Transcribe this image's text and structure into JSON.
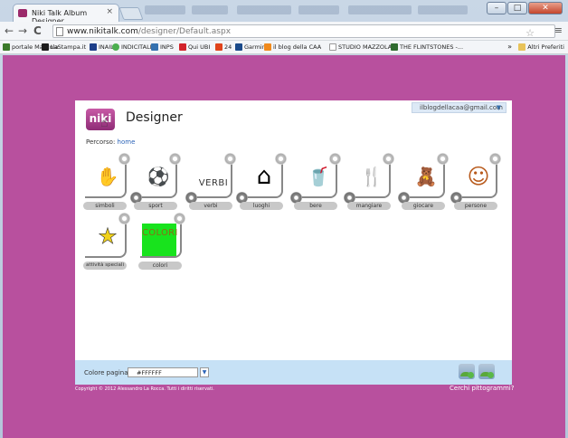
{
  "browser": {
    "tab_title": "Niki Talk Album Designer",
    "tab_close": "×",
    "url_host": "www.nikitalk.com",
    "url_path": "/designer/Default.aspx",
    "nav_back": "←",
    "nav_forward": "→",
    "nav_reload": "C",
    "star": "☆",
    "menu": "≡",
    "win_min": "–",
    "win_max": "□",
    "win_close": "✕",
    "bookmarks": [
      {
        "label": "portale Mazzola",
        "color": "#3b7a2a"
      },
      {
        "label": "LaStampa.it",
        "color": "#1d1d1d"
      },
      {
        "label": "INAIL",
        "color": "#1d3f8a"
      },
      {
        "label": "INDICITALIA",
        "color": "#4caf50"
      },
      {
        "label": "INPS",
        "color": "#3572b0"
      },
      {
        "label": "Qui UBI",
        "color": "#d2232a"
      },
      {
        "label": "24",
        "color": "#e0441b"
      },
      {
        "label": "Garmin",
        "color": "#1a4a8a"
      },
      {
        "label": "il blog della CAA",
        "color": "#f08a1c"
      },
      {
        "label": "STUDIO MAZZOLA",
        "color": "#cfd5dc"
      },
      {
        "label": "THE FLINTSTONES -...",
        "color": "#2f6b2f"
      }
    ],
    "bookmarks_more": "»",
    "other_bookmarks": "Altri Preferiti"
  },
  "app": {
    "logo": "niki",
    "title": "Designer",
    "user_email": "ilblogdellacaa@gmail.com",
    "breadcrumb_label": "Percorso:",
    "breadcrumb_home": "home",
    "albums": [
      {
        "label": "simboli",
        "pic": "✋",
        "type": "icon"
      },
      {
        "label": "sport",
        "pic": "⚽",
        "type": "icon"
      },
      {
        "label": "verbi",
        "pic": "VERBI",
        "type": "text"
      },
      {
        "label": "luoghi",
        "pic": "⌂",
        "type": "icon"
      },
      {
        "label": "bere",
        "pic": "🥤",
        "type": "icon"
      },
      {
        "label": "mangiare",
        "pic": "🍴",
        "type": "icon"
      },
      {
        "label": "giocare",
        "pic": "🧸",
        "type": "icon"
      },
      {
        "label": "persone",
        "pic": "☺",
        "type": "icon"
      },
      {
        "label": "attività speciali",
        "pic": "★",
        "type": "icon"
      },
      {
        "label": "colori",
        "pic": "COLORI",
        "type": "green"
      }
    ],
    "footer": {
      "color_label": "Colore pagina",
      "color_value": "#FFFFFF",
      "copyright": "Copyright © 2012 Alessandro La Rocca. Tutti i diritti riservati.",
      "cerchi": "Cerchi pittogrammi?"
    }
  },
  "colors": {
    "page_bg": "#b8509e",
    "footer_bg": "#c6e1f6",
    "green_card": "#18e31d"
  }
}
